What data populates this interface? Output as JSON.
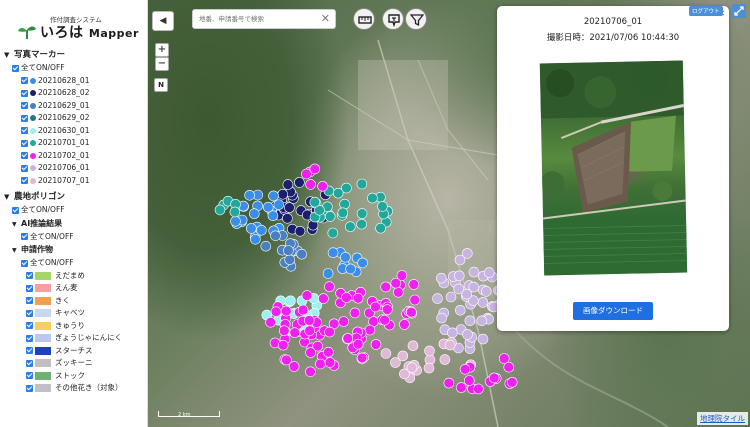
{
  "app": {
    "logo_sub": "作付調査システム",
    "logo_main": "いろは",
    "logo_main_en": "Mapper"
  },
  "sidebar": {
    "photo_section": "写真マーカー",
    "all_toggle": "全てON/OFF",
    "photo_items": [
      {
        "label": "20210628_01",
        "color": "#3a8ee8"
      },
      {
        "label": "20210628_02",
        "color": "#1c1f6b"
      },
      {
        "label": "20210629_01",
        "color": "#4a7fc0"
      },
      {
        "label": "20210629_02",
        "color": "#1e7a8a"
      },
      {
        "label": "20210630_01",
        "color": "#9ef0f0"
      },
      {
        "label": "20210701_01",
        "color": "#22a89a"
      },
      {
        "label": "20210702_01",
        "color": "#f020f0"
      },
      {
        "label": "20210706_01",
        "color": "#c8b4e0"
      },
      {
        "label": "20210707_01",
        "color": "#e0b8d8"
      }
    ],
    "polygon_section": "農地ポリゴン",
    "polygon_all": "全てON/OFF",
    "ai_section": "AI推論結果",
    "ai_all": "全てON/OFF",
    "crop_section": "申請作物",
    "crop_all": "全てON/OFF",
    "crop_items": [
      {
        "label": "えだまめ",
        "color": "#a6d66a"
      },
      {
        "label": "えん麦",
        "color": "#f4a0a0"
      },
      {
        "label": "きく",
        "color": "#f0a050"
      },
      {
        "label": "キャベツ",
        "color": "#c8d8f0"
      },
      {
        "label": "きゅうり",
        "color": "#f5d060"
      },
      {
        "label": "ぎょうじゃにんにく",
        "color": "#b8c8f0"
      },
      {
        "label": "スターチス",
        "color": "#2040c0"
      },
      {
        "label": "ズッキーニ",
        "color": "#c0c0c0"
      },
      {
        "label": "ストック",
        "color": "#70b070"
      },
      {
        "label": "その他花き（対象）",
        "color": "#c0c0c8"
      }
    ]
  },
  "map": {
    "search_placeholder": "地番、申請番号で検索",
    "zoom_in": "+",
    "zoom_out": "−",
    "north": "N",
    "scale_label": "2 km",
    "tile_credit": "地理院タイル",
    "collapse": "◀"
  },
  "popup": {
    "title": "20210706_01",
    "date": "撮影日時：2021/07/06 10:44:30",
    "download": "画像ダウンロード",
    "close": "✕"
  },
  "header": {
    "logout": "ログアウト"
  }
}
